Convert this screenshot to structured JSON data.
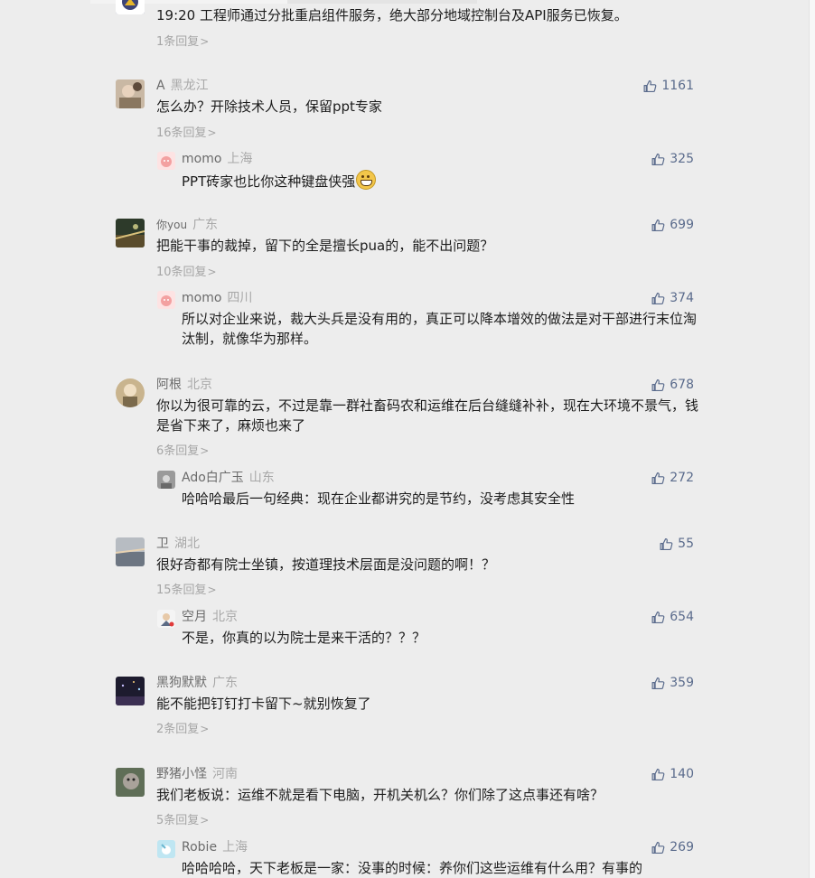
{
  "top_comment": {
    "text": "19:20 工程师通过分批重启组件服务，绝大部分地域控制台及API服务已恢复。",
    "replies": "1条回复"
  },
  "comments": [
    {
      "user": "A",
      "location": "黑龙江",
      "likes": "1161",
      "text": "怎么办？开除技术人员，保留ppt专家",
      "replies": "16条回复",
      "reply": {
        "user": "momo",
        "location": "上海",
        "likes": "325",
        "text": "PPT砖家也比你这种键盘侠强"
      }
    },
    {
      "user": "你you",
      "location": "广东",
      "likes": "699",
      "text": "把能干事的裁掉，留下的全是擅长pua的，能不出问题？",
      "replies": "10条回复",
      "reply": {
        "user": "momo",
        "location": "四川",
        "likes": "374",
        "text": "所以对企业来说，裁大头兵是没有用的，真正可以降本增效的做法是对干部进行末位淘汰制，就像华为那样。"
      }
    },
    {
      "user": "阿根",
      "location": "北京",
      "likes": "678",
      "text": "你以为很可靠的云，不过是靠一群社畜码农和运维在后台缝缝补补，现在大环境不景气，钱是省下来了，麻烦也来了",
      "replies": "6条回复",
      "reply": {
        "user": "Ado白广玉",
        "location": "山东",
        "likes": "272",
        "text": "哈哈哈最后一句经典：现在企业都讲究的是节约，没考虑其安全性"
      }
    },
    {
      "user": "卫",
      "location": "湖北",
      "likes": "55",
      "text": "很好奇都有院士坐镇，按道理技术层面是没问题的啊！？",
      "replies": "15条回复",
      "reply": {
        "user": "空月",
        "location": "北京",
        "likes": "654",
        "text": "不是，你真的以为院士是来干活的？？？"
      }
    },
    {
      "user": "黑狗默默",
      "location": "广东",
      "likes": "359",
      "text": "能不能把钉钉打卡留下~就别恢复了",
      "replies": "2条回复"
    },
    {
      "user": "野猪小怪",
      "location": "河南",
      "likes": "140",
      "text": "我们老板说：运维不就是看下电脑，开机关机么？你们除了这点事还有啥？",
      "replies": "5条回复",
      "reply": {
        "user": "Robie",
        "location": "上海",
        "likes": "269",
        "text": "哈哈哈哈，天下老板是一家：没事的时候：养你们这些运维有什么用？有事的"
      }
    }
  ],
  "icons": {
    "like": "thumbs-up-icon",
    "chevron": "chevron-right-icon",
    "emoji": "grin-emoji-icon"
  },
  "colors": {
    "background": "#ededed",
    "like": "#5a6b8c",
    "meta": "#8d8d8d",
    "text": "#1c1c1c"
  }
}
